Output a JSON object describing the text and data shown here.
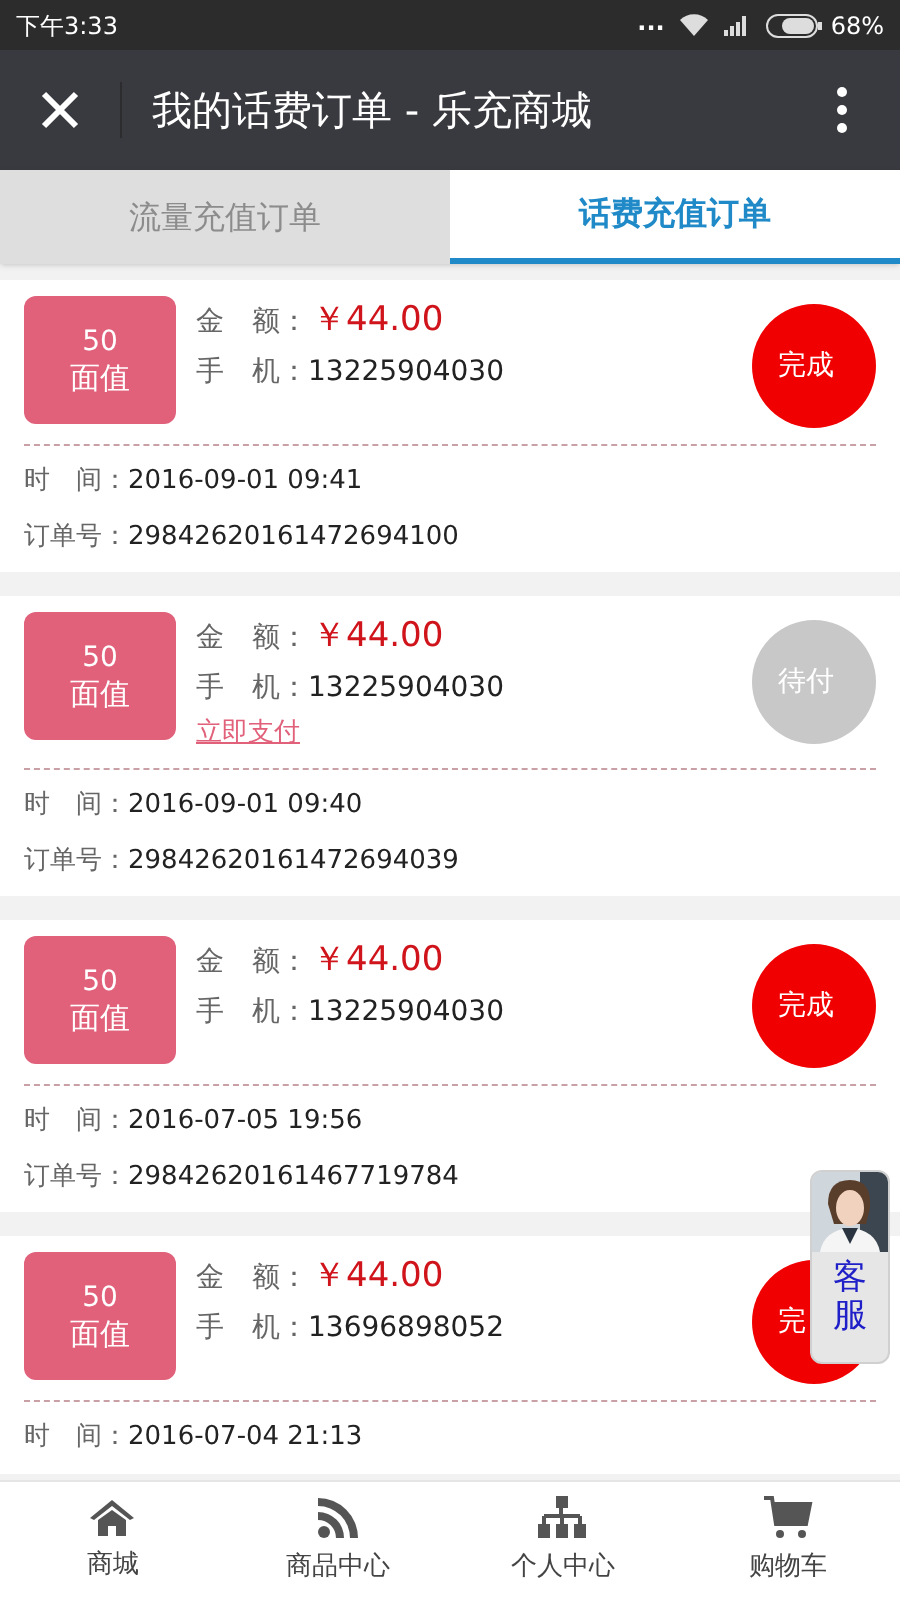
{
  "status_bar": {
    "time": "下午3:33",
    "dots": "...",
    "battery": "68%"
  },
  "header": {
    "title": "我的话费订单 - 乐充商城"
  },
  "tabs": [
    {
      "label": "流量充值订单",
      "selected": false
    },
    {
      "label": "话费充值订单",
      "selected": true
    }
  ],
  "orders": [
    {
      "face_value": "50",
      "face_label": "面值",
      "amount_label": "金　额：",
      "amount": "￥44.00",
      "phone_label": "手　机：",
      "phone": "13225904030",
      "kind": "done",
      "status_text": "完成",
      "time_label": "时　间：",
      "time": "2016-09-01 09:41",
      "order_label": "订单号：",
      "order_no": "29842620161472694100"
    },
    {
      "face_value": "50",
      "face_label": "面值",
      "amount_label": "金　额：",
      "amount": "￥44.00",
      "phone_label": "手　机：",
      "phone": "13225904030",
      "pay_link": "立即支付",
      "kind": "pending",
      "status_text": "待付",
      "time_label": "时　间：",
      "time": "2016-09-01 09:40",
      "order_label": "订单号：",
      "order_no": "29842620161472694039"
    },
    {
      "face_value": "50",
      "face_label": "面值",
      "amount_label": "金　额：",
      "amount": "￥44.00",
      "phone_label": "手　机：",
      "phone": "13225904030",
      "kind": "done",
      "status_text": "完成",
      "time_label": "时　间：",
      "time": "2016-07-05 19:56",
      "order_label": "订单号：",
      "order_no": "29842620161467719784"
    },
    {
      "face_value": "50",
      "face_label": "面值",
      "amount_label": "金　额：",
      "amount": "￥44.00",
      "phone_label": "手　机：",
      "phone": "13696898052",
      "kind": "done",
      "status_text": "完",
      "time_label": "时　间：",
      "time": "2016-07-04 21:13"
    }
  ],
  "service_widget": {
    "label": "客服"
  },
  "bottom_nav": [
    {
      "label": "商城",
      "kind": "home"
    },
    {
      "label": "商品中心",
      "kind": "feed"
    },
    {
      "label": "个人中心",
      "kind": "tree"
    },
    {
      "label": "购物车",
      "kind": "cart"
    }
  ]
}
